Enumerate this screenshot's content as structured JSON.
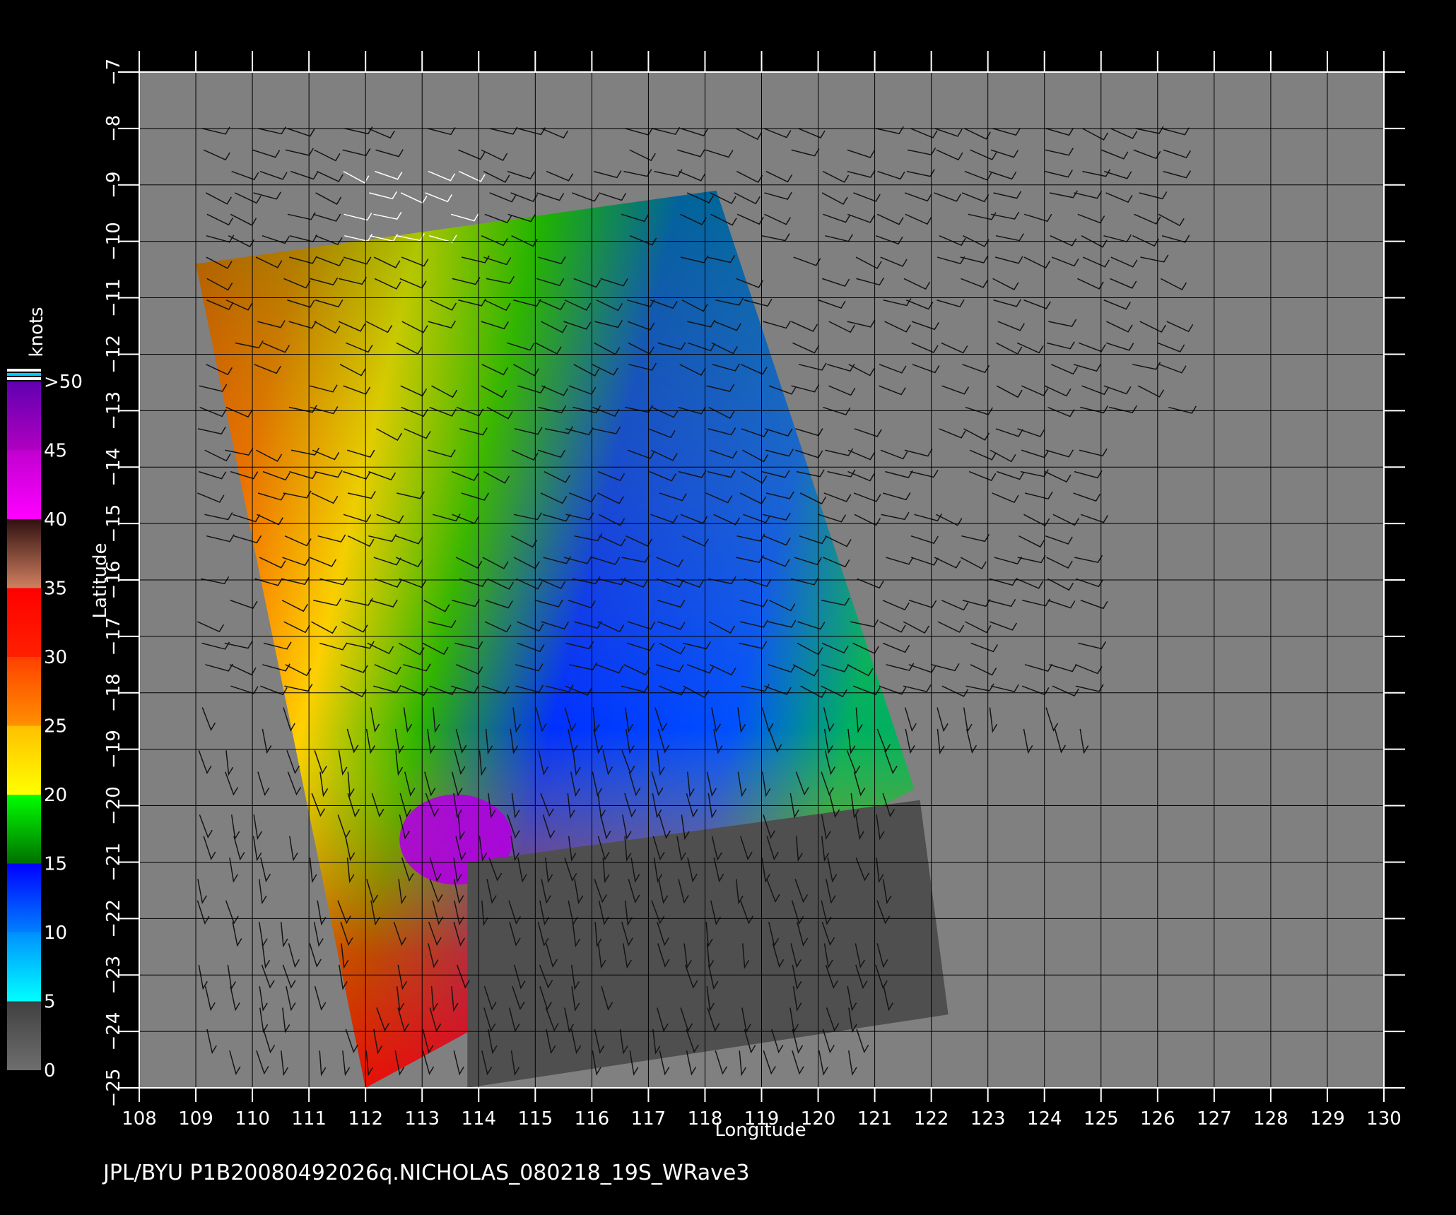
{
  "map": {
    "product_label": "JPL/BYU P1B20080492026q.NICHOLAS_080218_19S_WRave3",
    "x_axis_title": "Longitude",
    "y_axis_title": "Latitude",
    "x_ticks": [
      "108",
      "109",
      "110",
      "111",
      "112",
      "113",
      "114",
      "115",
      "116",
      "117",
      "118",
      "119",
      "120",
      "121",
      "122",
      "123",
      "124",
      "125",
      "126",
      "127",
      "128",
      "129",
      "130"
    ],
    "y_ticks": [
      "−7",
      "−8",
      "−9",
      "−10",
      "−11",
      "−12",
      "−13",
      "−14",
      "−15",
      "−16",
      "−17",
      "−18",
      "−19",
      "−20",
      "−21",
      "−22",
      "−23",
      "−24",
      "−25"
    ],
    "lon_range": [
      108,
      130
    ],
    "lat_range": [
      -7,
      -25
    ],
    "grid": true,
    "background_color": "#808080",
    "land_color": "#4f4f4f"
  },
  "colorbar": {
    "unit": "knots",
    "labels": [
      ">50",
      "45",
      "40",
      "35",
      "30",
      "25",
      "20",
      "15",
      "10",
      "5",
      "0"
    ],
    "bands": [
      {
        "from": 0,
        "to": 5,
        "colors": [
          "#6e6e6e",
          "#404040"
        ]
      },
      {
        "from": 5,
        "to": 10,
        "colors": [
          "#00ffff",
          "#0090ff"
        ]
      },
      {
        "from": 10,
        "to": 15,
        "colors": [
          "#0080ff",
          "#0000ff"
        ]
      },
      {
        "from": 15,
        "to": 20,
        "colors": [
          "#007000",
          "#00ff00"
        ]
      },
      {
        "from": 20,
        "to": 25,
        "colors": [
          "#ffff00",
          "#ffc000"
        ]
      },
      {
        "from": 25,
        "to": 30,
        "colors": [
          "#ff9000",
          "#ff4000"
        ]
      },
      {
        "from": 30,
        "to": 35,
        "colors": [
          "#ff2000",
          "#ff0000"
        ]
      },
      {
        "from": 35,
        "to": 40,
        "colors": [
          "#d08060",
          "#301010"
        ]
      },
      {
        "from": 40,
        "to": 45,
        "colors": [
          "#ff00ff",
          "#c000d0"
        ]
      },
      {
        "from": 45,
        "to": 50,
        "colors": [
          "#b000c0",
          "#6000b0"
        ]
      }
    ]
  },
  "swath": {
    "corners_lonlat": [
      [
        109.0,
        -10.4
      ],
      [
        118.2,
        -9.1
      ],
      [
        121.7,
        -19.7
      ],
      [
        112.0,
        -25.0
      ]
    ],
    "land_corners_lonlat": [
      [
        113.8,
        -25.0
      ],
      [
        113.8,
        -21.0
      ],
      [
        121.8,
        -19.9
      ],
      [
        122.3,
        -23.7
      ]
    ]
  }
}
